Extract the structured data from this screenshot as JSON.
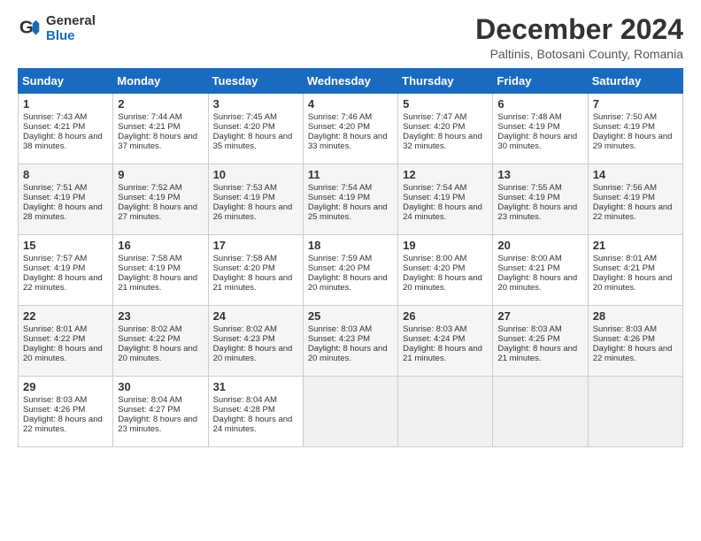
{
  "header": {
    "logo_general": "General",
    "logo_blue": "Blue",
    "title": "December 2024",
    "location": "Paltinis, Botosani County, Romania"
  },
  "weekdays": [
    "Sunday",
    "Monday",
    "Tuesday",
    "Wednesday",
    "Thursday",
    "Friday",
    "Saturday"
  ],
  "weeks": [
    [
      {
        "day": "1",
        "sunrise": "7:43 AM",
        "sunset": "4:21 PM",
        "daylight": "8 hours and 38 minutes."
      },
      {
        "day": "2",
        "sunrise": "7:44 AM",
        "sunset": "4:21 PM",
        "daylight": "8 hours and 37 minutes."
      },
      {
        "day": "3",
        "sunrise": "7:45 AM",
        "sunset": "4:20 PM",
        "daylight": "8 hours and 35 minutes."
      },
      {
        "day": "4",
        "sunrise": "7:46 AM",
        "sunset": "4:20 PM",
        "daylight": "8 hours and 33 minutes."
      },
      {
        "day": "5",
        "sunrise": "7:47 AM",
        "sunset": "4:20 PM",
        "daylight": "8 hours and 32 minutes."
      },
      {
        "day": "6",
        "sunrise": "7:48 AM",
        "sunset": "4:19 PM",
        "daylight": "8 hours and 30 minutes."
      },
      {
        "day": "7",
        "sunrise": "7:50 AM",
        "sunset": "4:19 PM",
        "daylight": "8 hours and 29 minutes."
      }
    ],
    [
      {
        "day": "8",
        "sunrise": "7:51 AM",
        "sunset": "4:19 PM",
        "daylight": "8 hours and 28 minutes."
      },
      {
        "day": "9",
        "sunrise": "7:52 AM",
        "sunset": "4:19 PM",
        "daylight": "8 hours and 27 minutes."
      },
      {
        "day": "10",
        "sunrise": "7:53 AM",
        "sunset": "4:19 PM",
        "daylight": "8 hours and 26 minutes."
      },
      {
        "day": "11",
        "sunrise": "7:54 AM",
        "sunset": "4:19 PM",
        "daylight": "8 hours and 25 minutes."
      },
      {
        "day": "12",
        "sunrise": "7:54 AM",
        "sunset": "4:19 PM",
        "daylight": "8 hours and 24 minutes."
      },
      {
        "day": "13",
        "sunrise": "7:55 AM",
        "sunset": "4:19 PM",
        "daylight": "8 hours and 23 minutes."
      },
      {
        "day": "14",
        "sunrise": "7:56 AM",
        "sunset": "4:19 PM",
        "daylight": "8 hours and 22 minutes."
      }
    ],
    [
      {
        "day": "15",
        "sunrise": "7:57 AM",
        "sunset": "4:19 PM",
        "daylight": "8 hours and 22 minutes."
      },
      {
        "day": "16",
        "sunrise": "7:58 AM",
        "sunset": "4:19 PM",
        "daylight": "8 hours and 21 minutes."
      },
      {
        "day": "17",
        "sunrise": "7:58 AM",
        "sunset": "4:20 PM",
        "daylight": "8 hours and 21 minutes."
      },
      {
        "day": "18",
        "sunrise": "7:59 AM",
        "sunset": "4:20 PM",
        "daylight": "8 hours and 20 minutes."
      },
      {
        "day": "19",
        "sunrise": "8:00 AM",
        "sunset": "4:20 PM",
        "daylight": "8 hours and 20 minutes."
      },
      {
        "day": "20",
        "sunrise": "8:00 AM",
        "sunset": "4:21 PM",
        "daylight": "8 hours and 20 minutes."
      },
      {
        "day": "21",
        "sunrise": "8:01 AM",
        "sunset": "4:21 PM",
        "daylight": "8 hours and 20 minutes."
      }
    ],
    [
      {
        "day": "22",
        "sunrise": "8:01 AM",
        "sunset": "4:22 PM",
        "daylight": "8 hours and 20 minutes."
      },
      {
        "day": "23",
        "sunrise": "8:02 AM",
        "sunset": "4:22 PM",
        "daylight": "8 hours and 20 minutes."
      },
      {
        "day": "24",
        "sunrise": "8:02 AM",
        "sunset": "4:23 PM",
        "daylight": "8 hours and 20 minutes."
      },
      {
        "day": "25",
        "sunrise": "8:03 AM",
        "sunset": "4:23 PM",
        "daylight": "8 hours and 20 minutes."
      },
      {
        "day": "26",
        "sunrise": "8:03 AM",
        "sunset": "4:24 PM",
        "daylight": "8 hours and 21 minutes."
      },
      {
        "day": "27",
        "sunrise": "8:03 AM",
        "sunset": "4:25 PM",
        "daylight": "8 hours and 21 minutes."
      },
      {
        "day": "28",
        "sunrise": "8:03 AM",
        "sunset": "4:26 PM",
        "daylight": "8 hours and 22 minutes."
      }
    ],
    [
      {
        "day": "29",
        "sunrise": "8:03 AM",
        "sunset": "4:26 PM",
        "daylight": "8 hours and 22 minutes."
      },
      {
        "day": "30",
        "sunrise": "8:04 AM",
        "sunset": "4:27 PM",
        "daylight": "8 hours and 23 minutes."
      },
      {
        "day": "31",
        "sunrise": "8:04 AM",
        "sunset": "4:28 PM",
        "daylight": "8 hours and 24 minutes."
      },
      null,
      null,
      null,
      null
    ]
  ]
}
